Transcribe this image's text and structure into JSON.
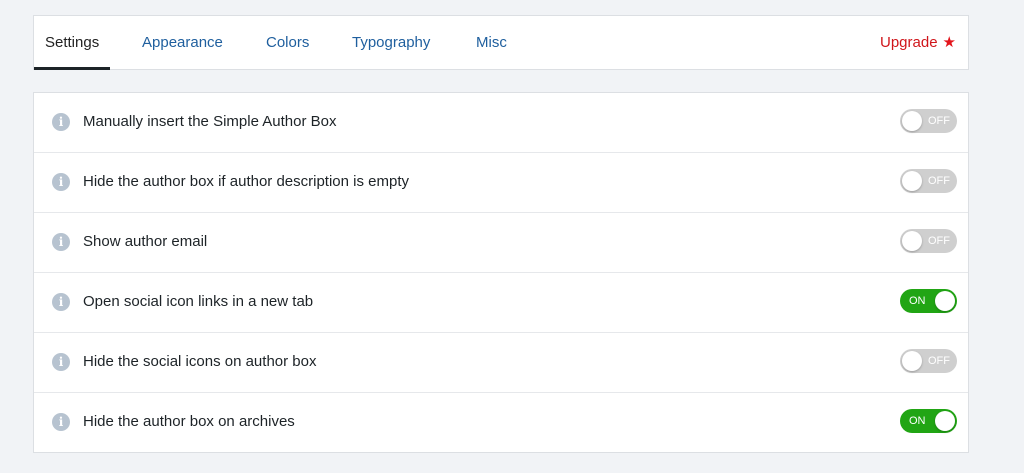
{
  "tabs": [
    {
      "label": "Settings",
      "active": true
    },
    {
      "label": "Appearance",
      "active": false
    },
    {
      "label": "Colors",
      "active": false
    },
    {
      "label": "Typography",
      "active": false
    },
    {
      "label": "Misc",
      "active": false
    }
  ],
  "upgrade": {
    "label": "Upgrade",
    "icon": "star-icon",
    "color": "#d0161b"
  },
  "settings": [
    {
      "label": "Manually insert the Simple Author Box",
      "state": "OFF"
    },
    {
      "label": "Hide the author box if author description is empty",
      "state": "OFF"
    },
    {
      "label": "Show author email",
      "state": "OFF"
    },
    {
      "label": "Open social icon links in a new tab",
      "state": "ON"
    },
    {
      "label": "Hide the social icons on author box",
      "state": "OFF"
    },
    {
      "label": "Hide the author box on archives",
      "state": "ON"
    }
  ],
  "colors": {
    "toggle_on": "#21a514",
    "toggle_off": "#cfcfcf",
    "tab_link": "#1f5f9e"
  }
}
